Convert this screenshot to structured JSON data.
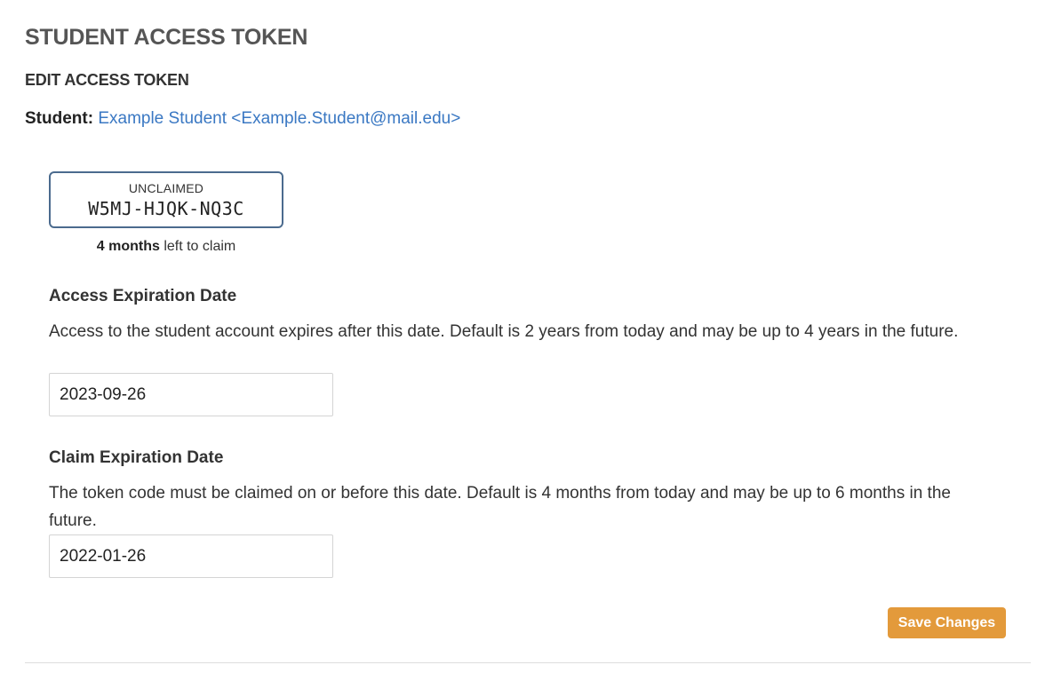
{
  "page": {
    "title": "STUDENT ACCESS TOKEN",
    "section_title": "EDIT ACCESS TOKEN"
  },
  "student": {
    "label": "Student:",
    "value": "Example Student <Example.Student@mail.edu>"
  },
  "token": {
    "status": "UNCLAIMED",
    "code": "W5MJ-HJQK-NQ3C",
    "time_left": "4 months",
    "time_left_suffix": " left to claim"
  },
  "access_expiration": {
    "heading": "Access Expiration Date",
    "help": "Access to the student account expires after this date. Default is 2 years from today and may be up to 4 years in the future.",
    "value": "2023-09-26"
  },
  "claim_expiration": {
    "heading": "Claim Expiration Date",
    "help": "The token code must be claimed on or before this date. Default is 4 months from today and may be up to 6 months in the future.",
    "value": "2022-01-26"
  },
  "actions": {
    "save_label": "Save Changes"
  },
  "colors": {
    "link": "#3a78c3",
    "token_border": "#4b6b8e",
    "save_button": "#e39a3b",
    "title": "#555555"
  }
}
